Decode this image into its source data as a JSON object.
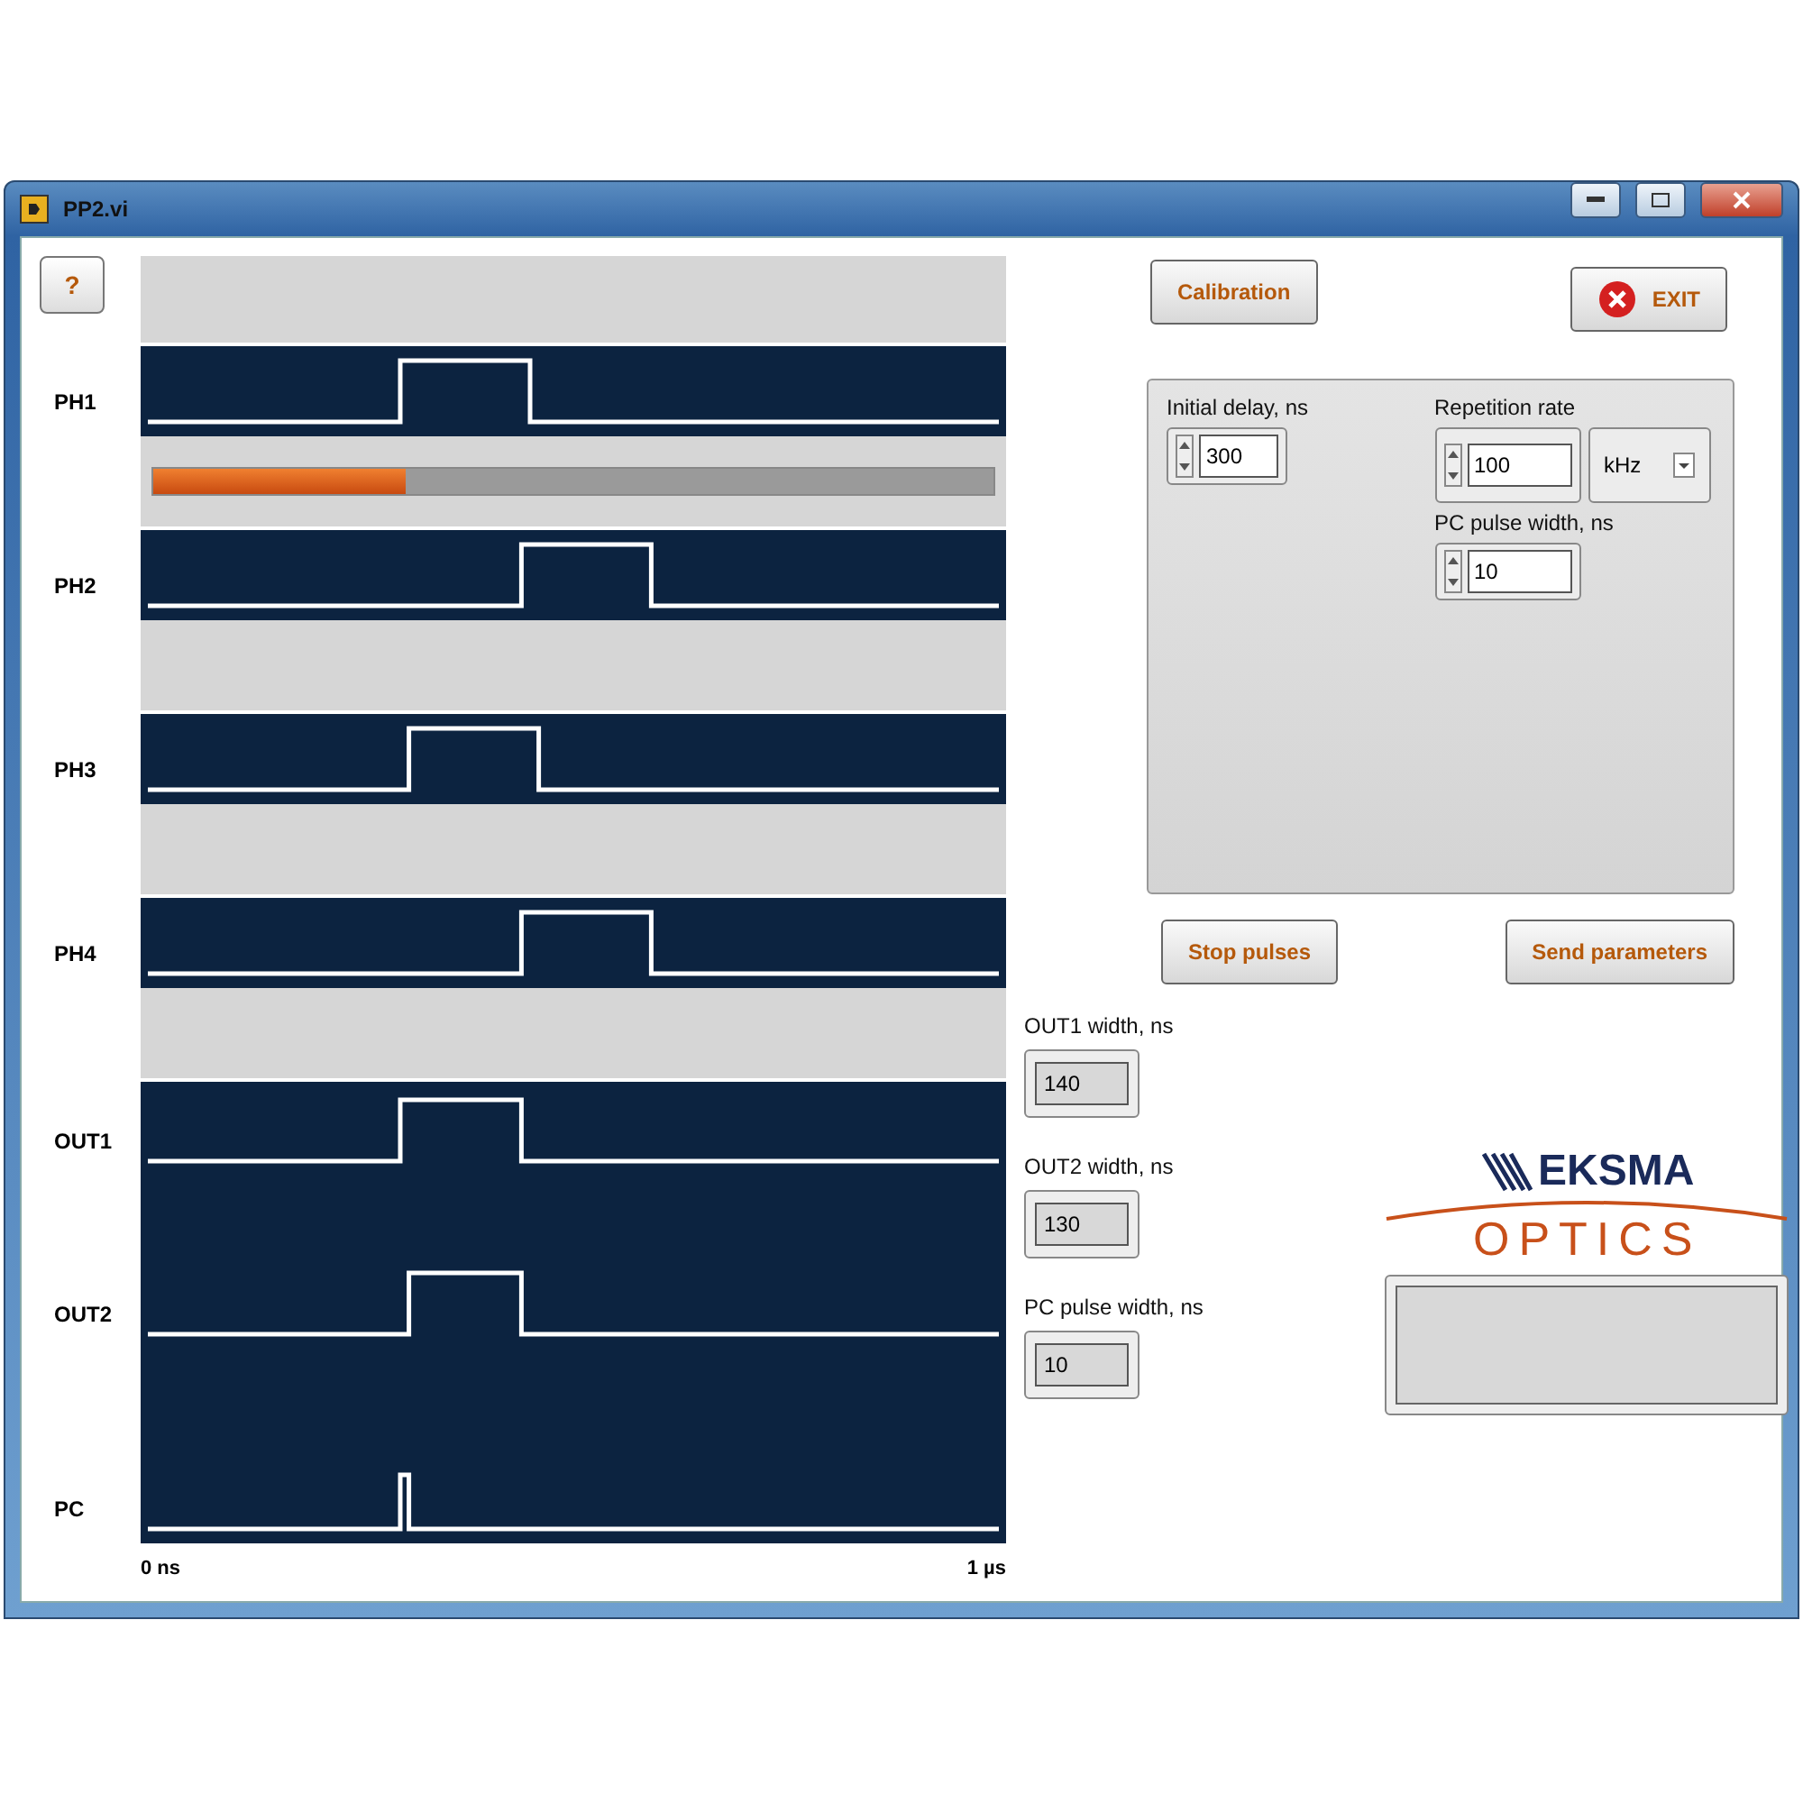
{
  "window": {
    "title": "PP2.vi"
  },
  "help_button": "?",
  "traces": [
    {
      "label": "PH1"
    },
    {
      "label": "PH2"
    },
    {
      "label": "PH3"
    },
    {
      "label": "PH4"
    },
    {
      "label": "OUT1"
    },
    {
      "label": "OUT2"
    },
    {
      "label": "PC"
    }
  ],
  "progress": {
    "level": 0.3
  },
  "axis": {
    "start": "0 ns",
    "end": "1 µs"
  },
  "buttons": {
    "calibration": "Calibration",
    "exit": "EXIT",
    "stop": "Stop pulses",
    "send": "Send parameters"
  },
  "settings": {
    "initial_delay": {
      "label": "Initial delay, ns",
      "value": "300"
    },
    "repetition_rate": {
      "label": "Repetition rate",
      "value": "100",
      "unit": "kHz"
    },
    "pc_pulse_width": {
      "label": "PC pulse width, ns",
      "value": "10"
    }
  },
  "outputs": [
    {
      "label": "OUT1 width, ns",
      "value": "140"
    },
    {
      "label": "OUT2 width, ns",
      "value": "130"
    },
    {
      "label": "PC pulse width, ns",
      "value": "10"
    }
  ],
  "logo": {
    "top": "EKSMA",
    "bottom": "OPTICS"
  }
}
